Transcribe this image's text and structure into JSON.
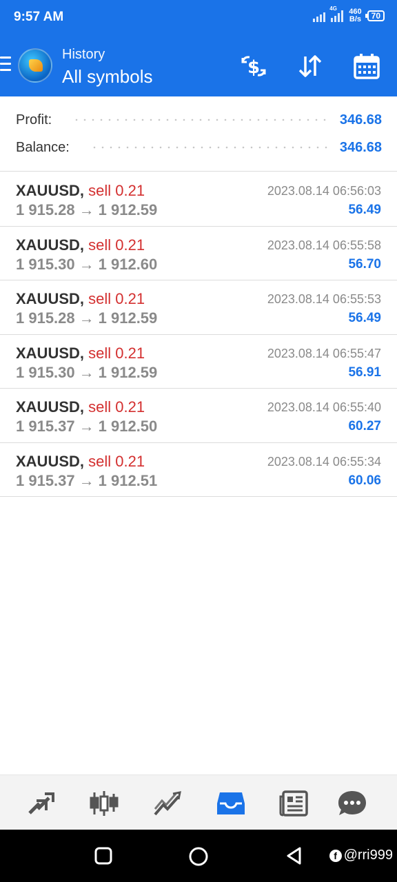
{
  "status_bar": {
    "time": "9:57 AM",
    "network_speed_value": "460",
    "network_speed_unit": "B/s",
    "network_type": "4G",
    "battery": "70"
  },
  "header": {
    "subtitle": "History",
    "title": "All symbols",
    "icons": [
      "menu-icon",
      "app-logo",
      "dollar-exchange-icon",
      "sort-icon",
      "calendar-icon"
    ]
  },
  "summary": {
    "profit_label": "Profit:",
    "profit_value": "346.68",
    "balance_label": "Balance:",
    "balance_value": "346.68"
  },
  "trades": [
    {
      "symbol": "XAUUSD,",
      "side": "sell 0.21",
      "open": "1 915.28",
      "arrow": "→",
      "close": "1 912.59",
      "time": "2023.08.14 06:56:03",
      "profit": "56.49"
    },
    {
      "symbol": "XAUUSD,",
      "side": "sell 0.21",
      "open": "1 915.30",
      "arrow": "→",
      "close": "1 912.60",
      "time": "2023.08.14 06:55:58",
      "profit": "56.70"
    },
    {
      "symbol": "XAUUSD,",
      "side": "sell 0.21",
      "open": "1 915.28",
      "arrow": "→",
      "close": "1 912.59",
      "time": "2023.08.14 06:55:53",
      "profit": "56.49"
    },
    {
      "symbol": "XAUUSD,",
      "side": "sell 0.21",
      "open": "1 915.30",
      "arrow": "→",
      "close": "1 912.59",
      "time": "2023.08.14 06:55:47",
      "profit": "56.91"
    },
    {
      "symbol": "XAUUSD,",
      "side": "sell 0.21",
      "open": "1 915.37",
      "arrow": "→",
      "close": "1 912.50",
      "time": "2023.08.14 06:55:40",
      "profit": "60.27"
    },
    {
      "symbol": "XAUUSD,",
      "side": "sell 0.21",
      "open": "1 915.37",
      "arrow": "→",
      "close": "1 912.51",
      "time": "2023.08.14 06:55:34",
      "profit": "60.06"
    }
  ],
  "bottom_nav": {
    "items": [
      "quotes-icon",
      "chart-icon",
      "trade-icon",
      "history-icon",
      "news-icon",
      "chat-icon"
    ],
    "active": "history-icon"
  },
  "colors": {
    "primary": "#1a73e8",
    "sell": "#d32f2f",
    "muted": "#8a8a8a"
  },
  "watermark": "@rri999"
}
